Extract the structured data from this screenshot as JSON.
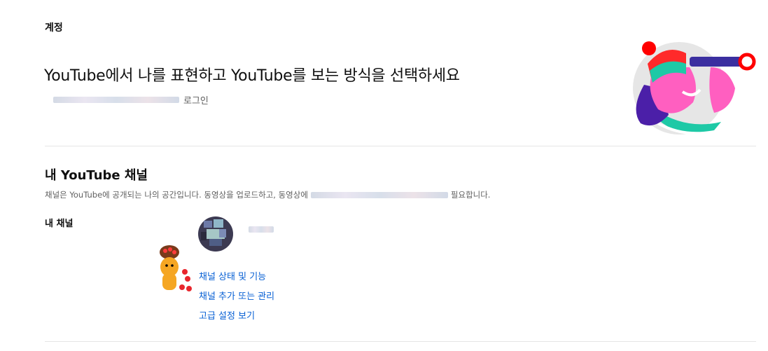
{
  "account": {
    "section_title": "계정",
    "headline": "YouTube에서 나를 표현하고 YouTube를 보는 방식을 선택하세요",
    "login_suffix": "로그인"
  },
  "my_channel": {
    "heading": "내 YouTube 채널",
    "description_prefix": "채널은 YouTube에 공개되는 나의 공간입니다. 동영상을 업로드하고, 동영상에",
    "description_suffix": "필요합니다.",
    "label": "내 채널",
    "links": {
      "status": "채널 상태 및 기능",
      "manage": "채널 추가 또는 관리",
      "advanced": "고급 설정 보기"
    }
  },
  "colors": {
    "link": "#065fd4",
    "divider": "#e5e5e5",
    "secondary_text": "#606060"
  }
}
